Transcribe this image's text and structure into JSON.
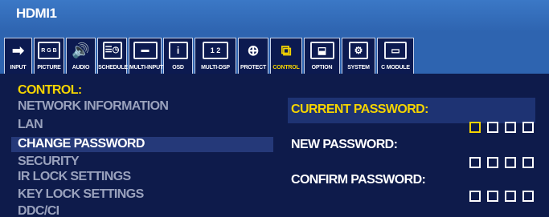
{
  "window": {
    "title": "HDMI1"
  },
  "toolbar": {
    "tabs": [
      {
        "label": "INPUT",
        "icon": "input-arrow-icon",
        "glyph": "➡"
      },
      {
        "label": "PICTURE",
        "icon": "rgb-picture-icon",
        "glyph": "R G B"
      },
      {
        "label": "AUDIO",
        "icon": "speaker-icon",
        "glyph": "🔊"
      },
      {
        "label": "SCHEDULE",
        "icon": "schedule-clock-icon",
        "glyph": "☰◷"
      },
      {
        "label": "MULTI-INPUT",
        "icon": "multi-input-icon",
        "glyph": "▬"
      },
      {
        "label": "OSD",
        "icon": "osd-info-icon",
        "glyph": "i"
      },
      {
        "label": "MULTI-DSP",
        "icon": "multi-display-icon",
        "glyph": "1 2"
      },
      {
        "label": "PROTECT",
        "icon": "shield-plus-icon",
        "glyph": "⊕"
      },
      {
        "label": "CONTROL",
        "icon": "control-network-icon",
        "glyph": "⧉"
      },
      {
        "label": "OPTION",
        "icon": "option-screen-icon",
        "glyph": "⬓"
      },
      {
        "label": "SYSTEM",
        "icon": "gear-icon",
        "glyph": "⚙"
      },
      {
        "label": "C MODULE",
        "icon": "compute-module-icon",
        "glyph": "▭"
      }
    ],
    "active": "CONTROL"
  },
  "menu": {
    "header": "CONTROL:",
    "items": [
      "NETWORK INFORMATION",
      "LAN",
      "CHANGE PASSWORD",
      "SECURITY",
      "IR LOCK SETTINGS",
      "KEY LOCK SETTINGS",
      "DDC/CI"
    ],
    "selected": "CHANGE PASSWORD"
  },
  "password": {
    "current_label": "CURRENT PASSWORD:",
    "new_label": "NEW PASSWORD:",
    "confirm_label": "CONFIRM PASSWORD:",
    "digits_per_field": 4
  },
  "colors": {
    "accent": "#f5d400",
    "title_bar": "#3b78c6",
    "background": "#0e1b4b",
    "dimmed_text": "#9aa2bd"
  }
}
